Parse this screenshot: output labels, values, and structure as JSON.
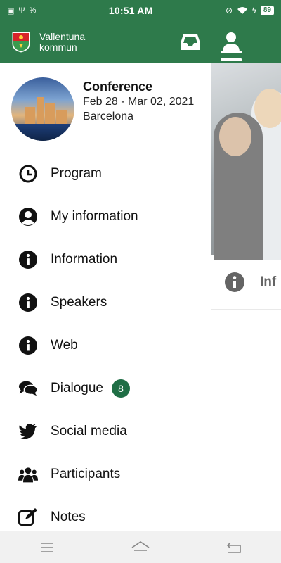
{
  "status_bar": {
    "time": "10:51 AM",
    "battery": "89",
    "left_icons": [
      "excel-icon",
      "usb-icon",
      "percent-icon"
    ],
    "right_icons": [
      "mute-icon",
      "wifi-icon",
      "charging-icon"
    ]
  },
  "header": {
    "brand_line1": "Vallentuna",
    "brand_line2": "kommun",
    "icons": [
      "inbox-icon",
      "user-icon",
      "hamburger-menu-icon"
    ]
  },
  "conference": {
    "title": "Conference",
    "dates": "Feb 28 - Mar 02, 2021",
    "location": "Barcelona"
  },
  "menu": [
    {
      "label": "Program",
      "icon": "clock-icon"
    },
    {
      "label": "My information",
      "icon": "user-circle-icon"
    },
    {
      "label": "Information",
      "icon": "info-icon"
    },
    {
      "label": "Speakers",
      "icon": "info-icon"
    },
    {
      "label": "Web",
      "icon": "info-icon"
    },
    {
      "label": "Dialogue",
      "icon": "comments-icon",
      "badge": "8"
    },
    {
      "label": "Social media",
      "icon": "twitter-icon"
    },
    {
      "label": "Participants",
      "icon": "users-icon"
    },
    {
      "label": "Notes",
      "icon": "edit-icon"
    }
  ],
  "background_page": {
    "row_label": "Inf"
  },
  "colors": {
    "brand_green": "#2e7a4b",
    "badge_green": "#1f6e45"
  }
}
